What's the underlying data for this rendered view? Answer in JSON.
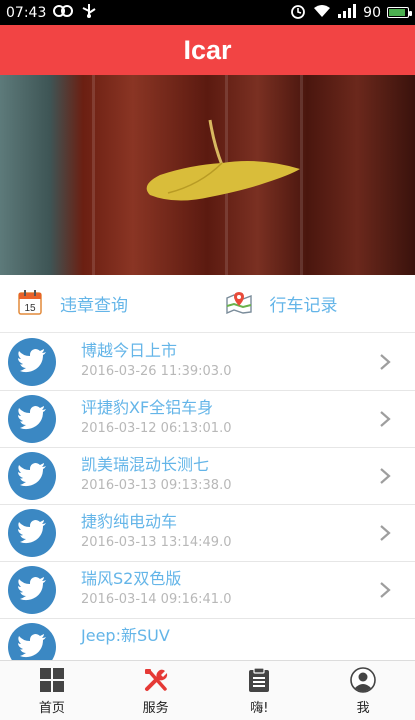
{
  "status_bar": {
    "time": "07:43",
    "battery": "90",
    "battery_level": 0.9
  },
  "header": {
    "title": "Icar"
  },
  "quick_actions": [
    {
      "label": "违章查询",
      "icon": "calendar-icon"
    },
    {
      "label": "行车记录",
      "icon": "map-icon"
    }
  ],
  "news": [
    {
      "title": "博越今日上市",
      "date": "2016-03-26 11:39:03.0"
    },
    {
      "title": "评捷豹XF全铝车身",
      "date": "2016-03-12 06:13:01.0"
    },
    {
      "title": "凯美瑞混动长测七",
      "date": "2016-03-13 09:13:38.0"
    },
    {
      "title": "捷豹纯电动车",
      "date": "2016-03-13 13:14:49.0"
    },
    {
      "title": "瑞风S2双色版",
      "date": "2016-03-14 09:16:41.0"
    },
    {
      "title": "Jeep:新SUV",
      "date": ""
    }
  ],
  "calendar_day": "15",
  "bottom_nav": [
    {
      "label": "首页",
      "icon": "grid-icon"
    },
    {
      "label": "服务",
      "icon": "tools-icon"
    },
    {
      "label": "嗨!",
      "icon": "clipboard-icon"
    },
    {
      "label": "我",
      "icon": "user-icon"
    }
  ],
  "colors": {
    "accent": "#f24444",
    "link": "#64b5e8",
    "avatar": "#3b88c3"
  }
}
